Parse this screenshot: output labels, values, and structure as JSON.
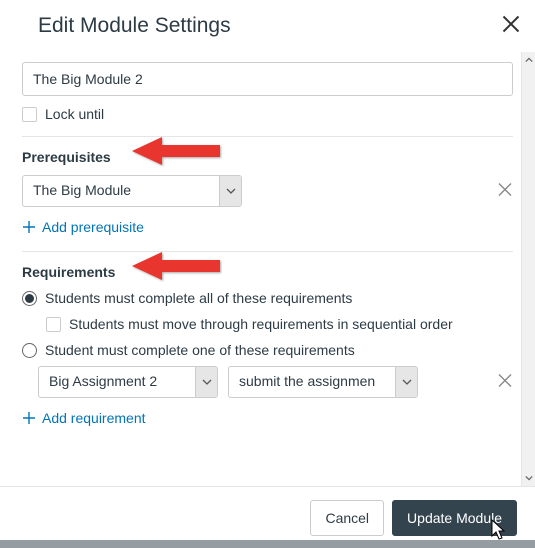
{
  "modal": {
    "title": "Edit Module Settings"
  },
  "module": {
    "name": "The Big Module 2",
    "lock_until_label": "Lock until"
  },
  "prerequisites": {
    "heading": "Prerequisites",
    "selected": "The Big Module",
    "add_label": "Add prerequisite"
  },
  "requirements": {
    "heading": "Requirements",
    "option_all": "Students must complete all of these requirements",
    "option_sequential": "Students must move through requirements in sequential order",
    "option_one": "Student must complete one of these requirements",
    "item_select": "Big Assignment 2",
    "rule_select": "submit the assignmen",
    "add_label": "Add requirement"
  },
  "footer": {
    "cancel": "Cancel",
    "update": "Update Module"
  }
}
